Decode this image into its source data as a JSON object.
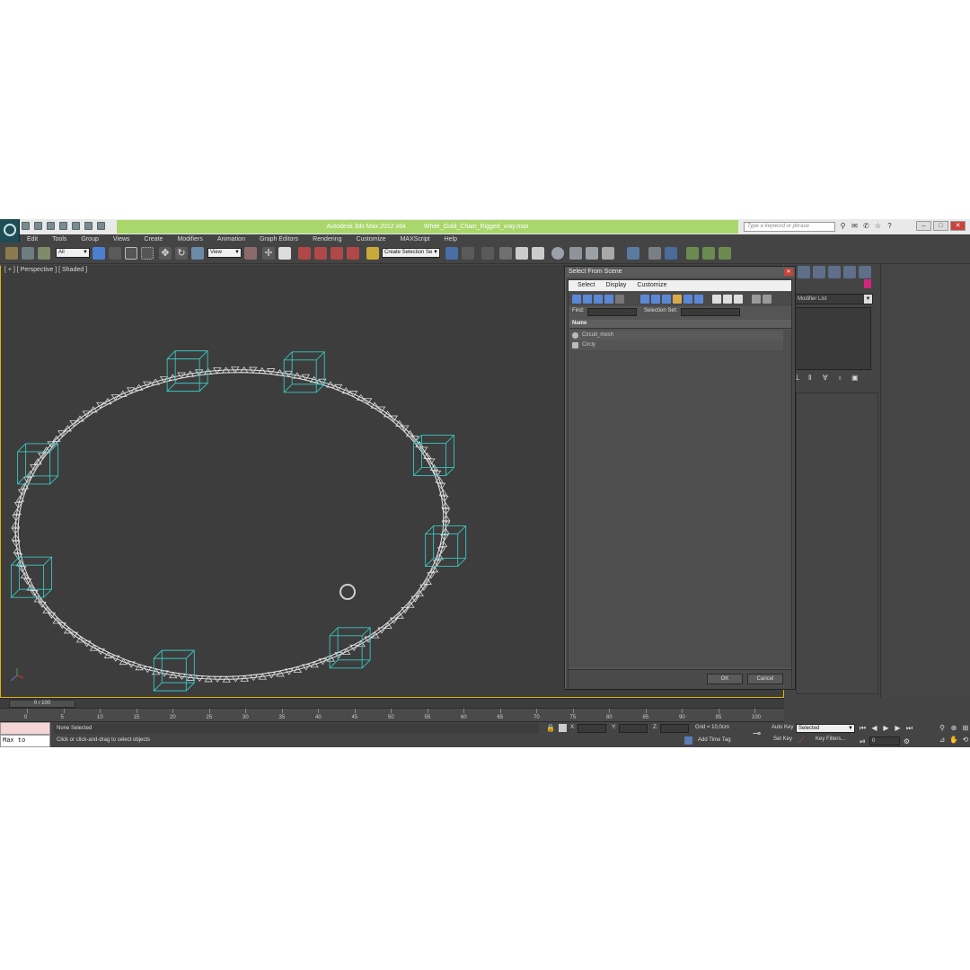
{
  "window": {
    "title_app": "Autodesk 3ds Max  2012 x64",
    "title_file": "White_Gold_Chain_Rigged_vray.max",
    "search_placeholder": "Type a keyword or phrase"
  },
  "menu": [
    "Edit",
    "Tools",
    "Group",
    "Views",
    "Create",
    "Modifiers",
    "Animation",
    "Graph Editors",
    "Rendering",
    "Customize",
    "MAXScript",
    "Help"
  ],
  "toolbar": {
    "filter_value": "All",
    "coord_value": "View",
    "named_selection_value": "Create Selection Se"
  },
  "viewport": {
    "label": "[ + ] [ Perspective ] [ Shaded ]"
  },
  "command_panel": {
    "modifier_list_label": "Modifier List"
  },
  "dialog": {
    "title": "Select From Scene",
    "close_glyph": "✕",
    "menu": [
      "Select",
      "Display",
      "Customize"
    ],
    "find_label": "Find:",
    "find_value": "",
    "selection_set_label": "Selection Set:",
    "selection_set_value": "",
    "column_name": "Name",
    "rows": [
      {
        "name": "Circuit_mesh",
        "icon": "sphere-object-icon"
      },
      {
        "name": "Circly",
        "icon": "shape-object-icon"
      }
    ],
    "ok_label": "OK",
    "cancel_label": "Cancel"
  },
  "timeline": {
    "slider_label": "0 / 100",
    "ticks": [
      "0",
      "5",
      "10",
      "15",
      "20",
      "25",
      "30",
      "35",
      "40",
      "45",
      "50",
      "55",
      "60",
      "65",
      "70",
      "75",
      "80",
      "85",
      "90",
      "95",
      "100"
    ]
  },
  "status": {
    "maxscript_output": "Max to Physc.",
    "selection": "None Selected",
    "prompt": "Click or click-and-drag to select objects",
    "x_label": "X:",
    "y_label": "Y:",
    "z_label": "Z:",
    "grid": "Grid = 10,0cm",
    "add_time_tag": "Add Time Tag",
    "auto_key": "Auto Key",
    "set_key": "Set Key",
    "key_mode_value": "Selected",
    "key_filters": "Key Filters...",
    "frame_value": "0"
  }
}
